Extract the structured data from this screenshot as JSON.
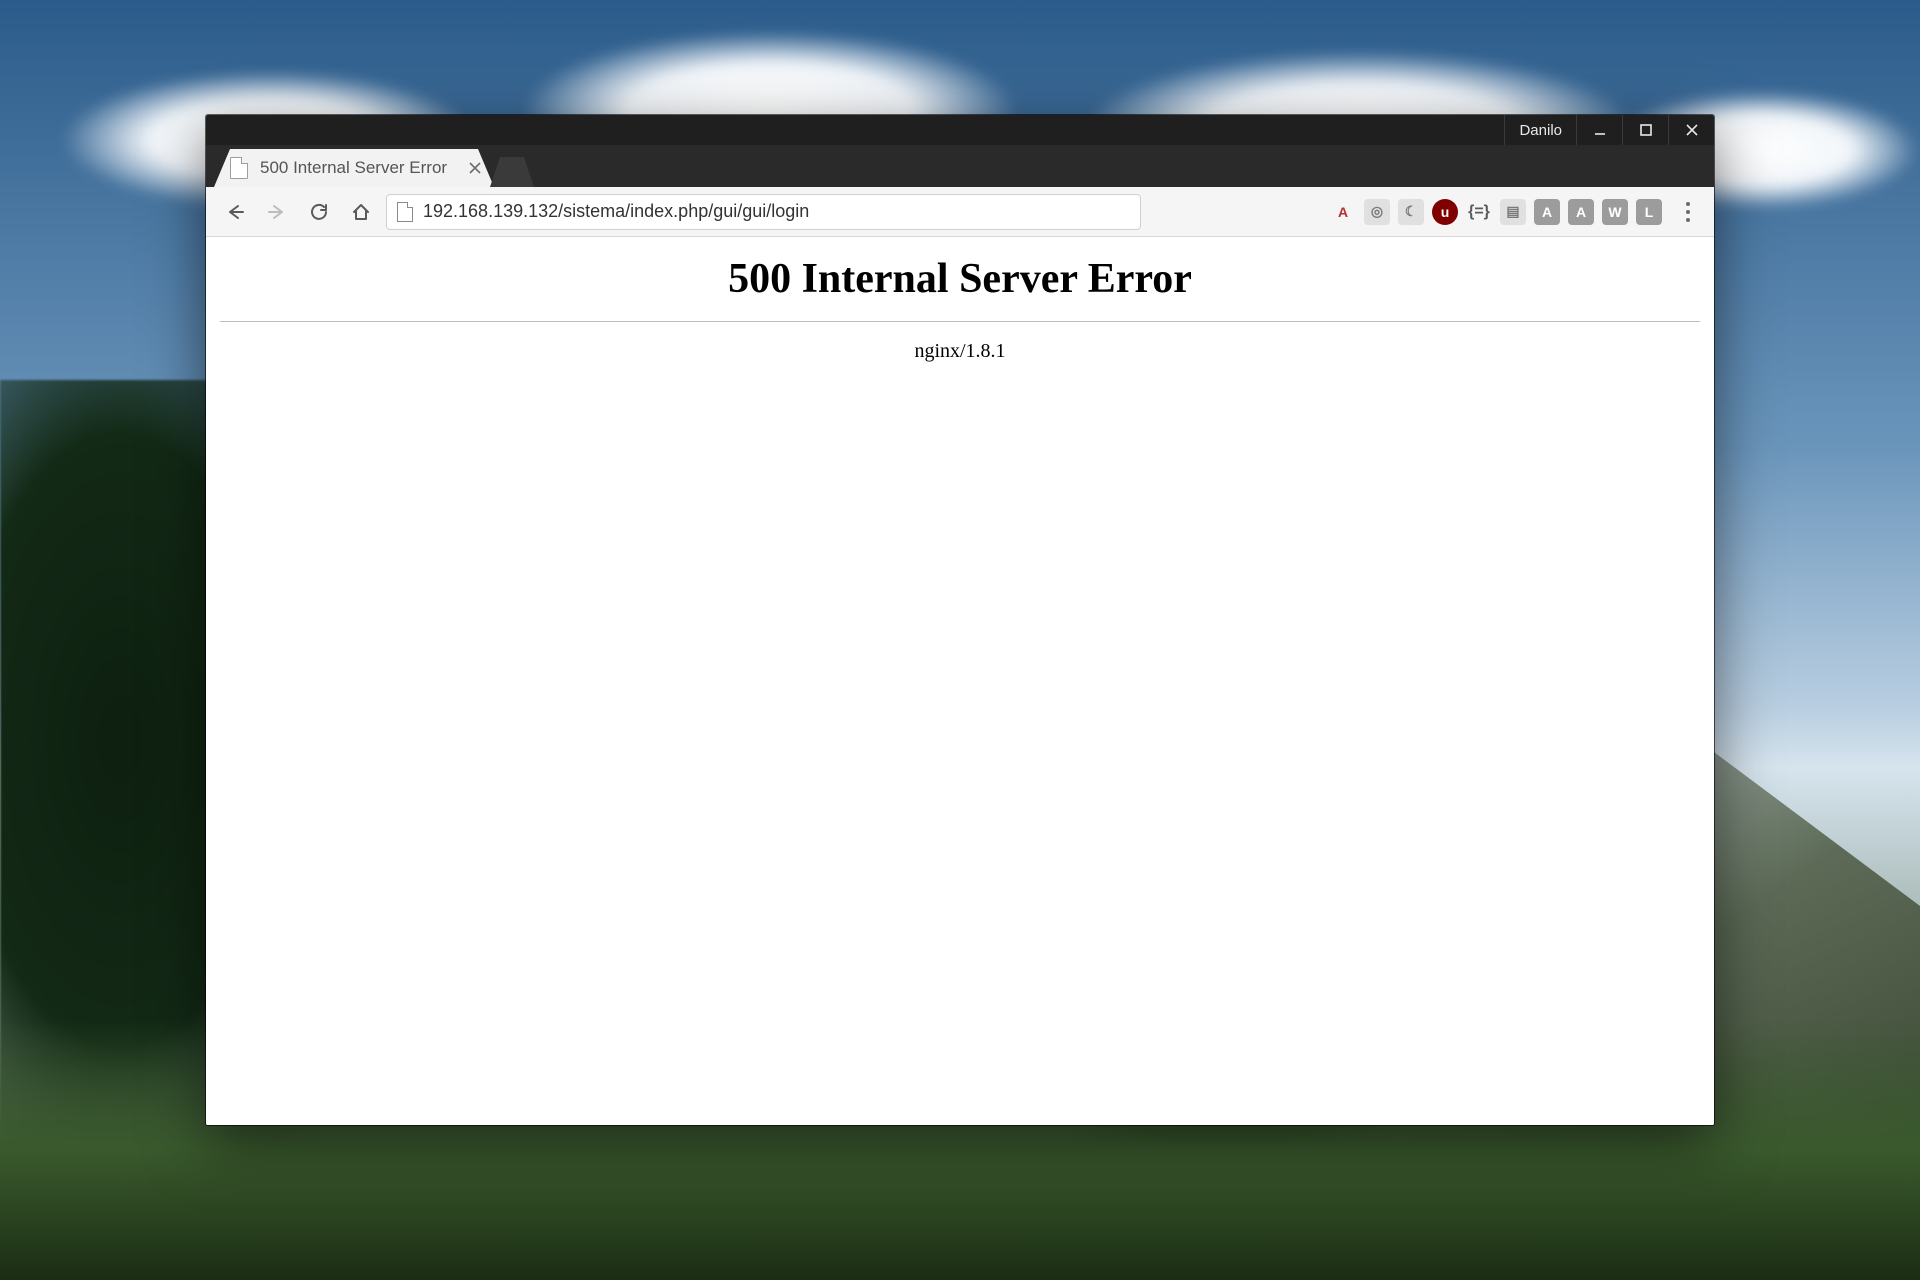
{
  "window": {
    "user_label": "Danilo",
    "controls": {
      "minimize": "minimize-icon",
      "maximize": "maximize-icon",
      "close": "close-icon"
    }
  },
  "tab": {
    "title": "500 Internal Server Error"
  },
  "toolbar": {
    "url": "192.168.139.132/sistema/index.php/gui/gui/login",
    "extensions": [
      {
        "name": "angular-devtools-icon",
        "glyph": "A",
        "variant": "angular"
      },
      {
        "name": "brave-shield-icon",
        "glyph": "◎",
        "variant": "plain"
      },
      {
        "name": "crescent-icon",
        "glyph": "☾",
        "variant": "plain"
      },
      {
        "name": "ublock-icon",
        "glyph": "u",
        "variant": "ublock"
      },
      {
        "name": "brackets-icon",
        "glyph": "{=}",
        "variant": "brackets"
      },
      {
        "name": "box-icon",
        "glyph": "▤",
        "variant": "plain"
      },
      {
        "name": "letter-a-icon",
        "glyph": "A",
        "variant": "letter"
      },
      {
        "name": "letter-a2-icon",
        "glyph": "A",
        "variant": "letter"
      },
      {
        "name": "letter-w-icon",
        "glyph": "W",
        "variant": "letter"
      },
      {
        "name": "letter-l-icon",
        "glyph": "L",
        "variant": "letter"
      }
    ]
  },
  "page": {
    "heading": "500 Internal Server Error",
    "server_line": "nginx/1.8.1"
  }
}
